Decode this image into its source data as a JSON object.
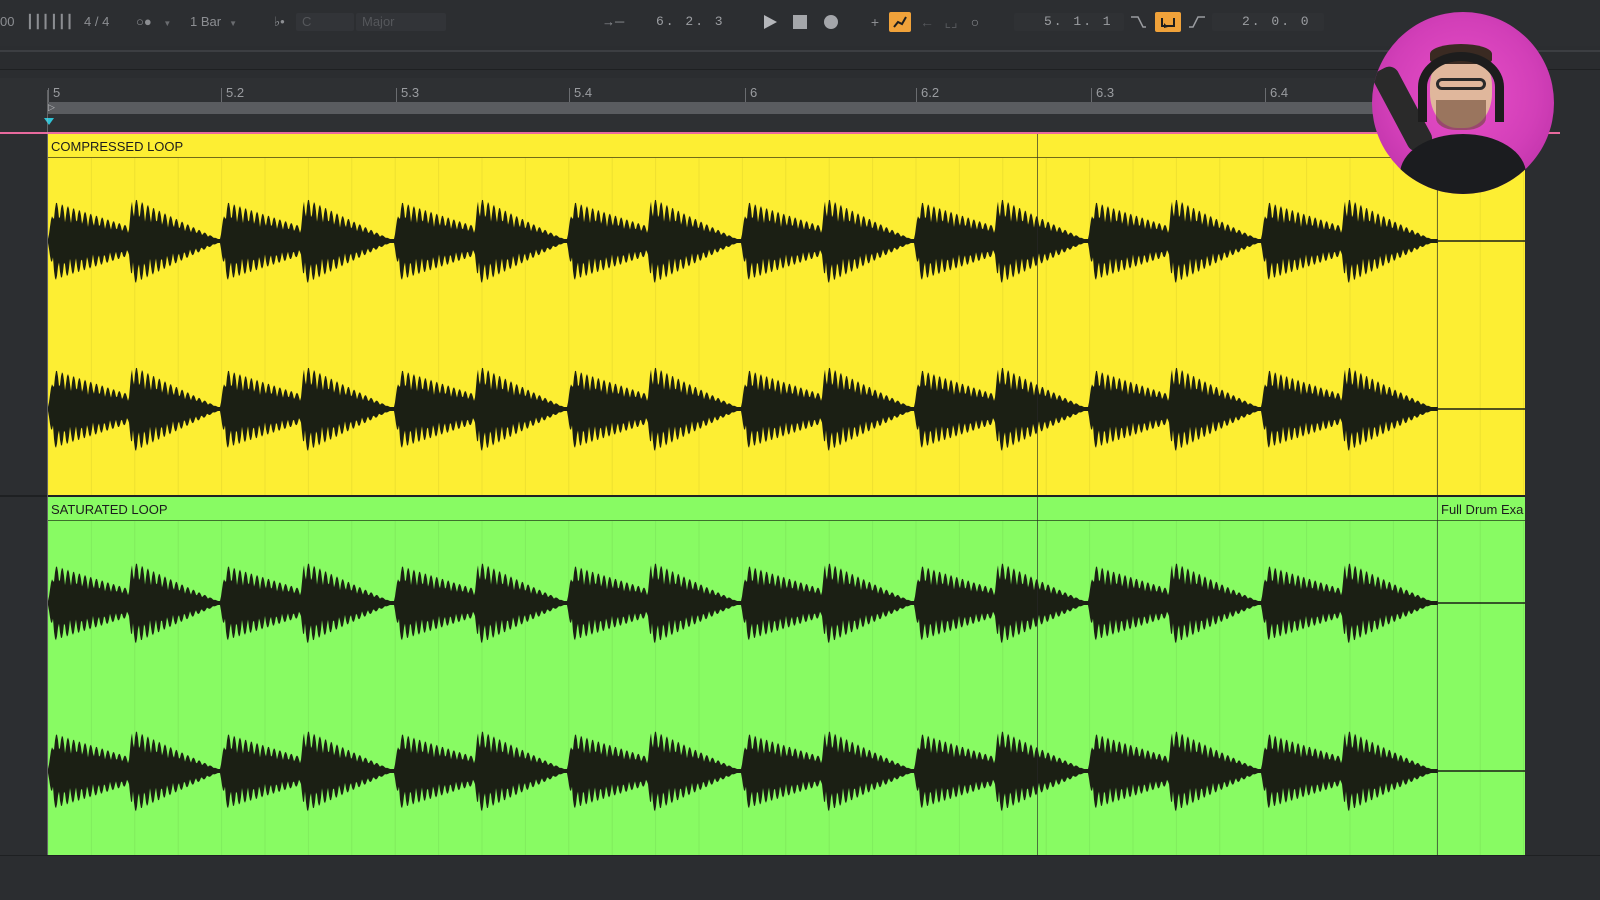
{
  "transport": {
    "tempo_partial": "00",
    "time_signature": "4 / 4",
    "quantize": "1 Bar",
    "key": "C",
    "scale": "Major",
    "arrangement_position": "6.  2.  3",
    "loop_start": "5.  1.  1",
    "loop_length": "2.  0.  0"
  },
  "ruler": {
    "labels": [
      "5",
      "5.2",
      "5.3",
      "5.4",
      "6",
      "6.2",
      "6.3",
      "6.4"
    ]
  },
  "clips": [
    {
      "name": "COMPRESSED LOOP",
      "color": "#fdee33"
    },
    {
      "name": "SATURATED LOOP",
      "color": "#88fb63",
      "next_clip_name": "Full Drum Exa"
    }
  ],
  "icons": {
    "play": "play-icon",
    "stop": "stop-icon",
    "record": "record-icon",
    "automation_arm": "automation-arm-icon",
    "loop": "loop-icon",
    "metronome": "metronome-icon"
  }
}
